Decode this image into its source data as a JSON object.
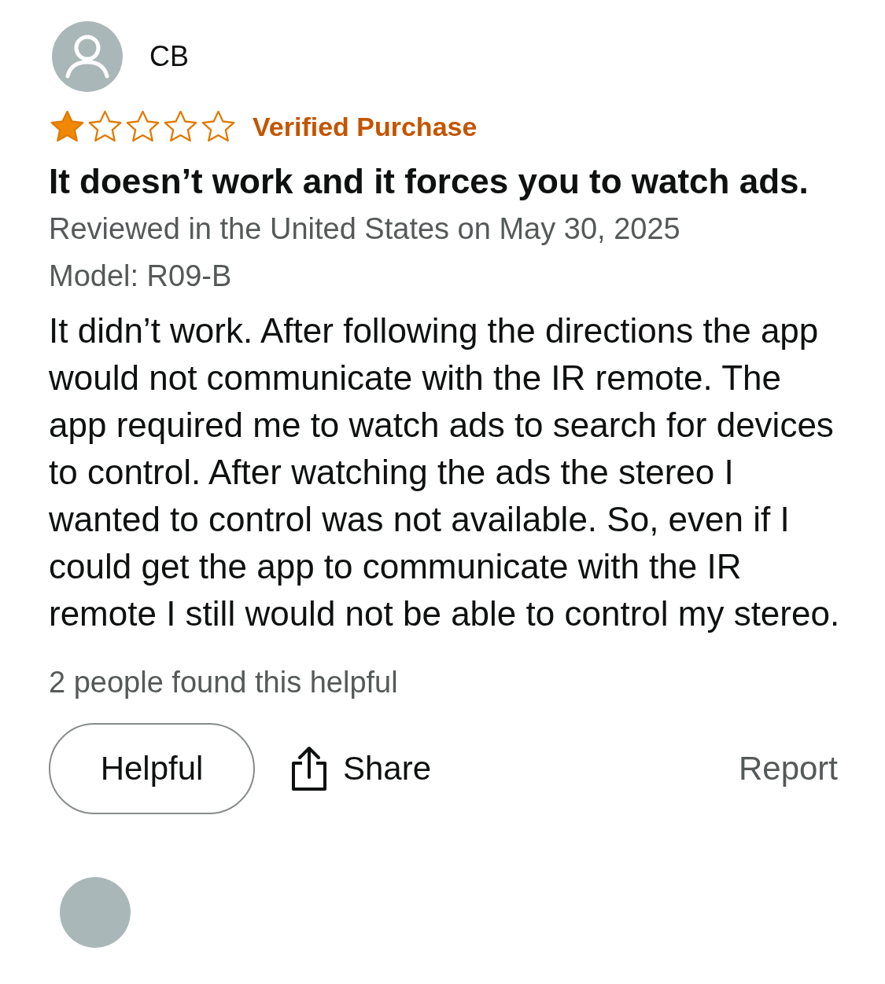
{
  "review": {
    "author": "CB",
    "stars": 1,
    "badge": "Verified Purchase",
    "title": "It doesn’t work and it forces you to watch ads.",
    "meta": "Reviewed in the United States on May 30, 2025",
    "model": "Model: R09-B",
    "body": "It didn’t work. After following the directions the app would not communicate with the IR remote. The app required me to watch ads to search for devices to control. After watching the ads the stereo I wanted to control was not available. So, even if I could get the app to communicate with the IR remote I still would not be able to control my stereo.",
    "helpful_count": "2 people found this helpful",
    "actions": {
      "helpful": "Helpful",
      "share": "Share",
      "report": "Report"
    }
  }
}
